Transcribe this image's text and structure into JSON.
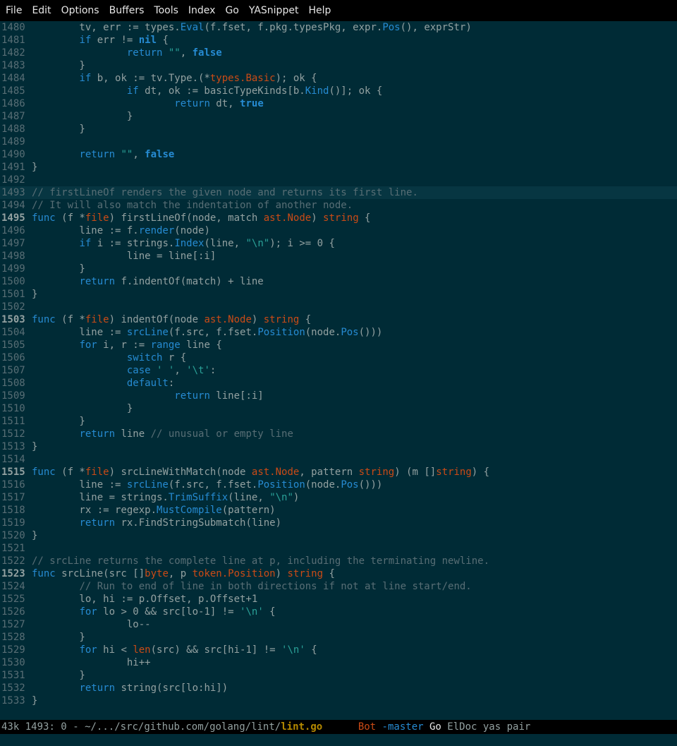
{
  "menu": [
    "File",
    "Edit",
    "Options",
    "Buffers",
    "Tools",
    "Index",
    "Go",
    "YASnippet",
    "Help"
  ],
  "colors": {
    "background": "#002b36",
    "keyword": "#268bd2",
    "type": "#cb4b16",
    "string": "#2aa198",
    "comment": "#586e75",
    "text": "#93a1a1"
  },
  "lines": [
    {
      "n": "1480",
      "tokens": [
        [
          "",
          "        tv, err := types."
        ],
        [
          "call",
          "Eval"
        ],
        [
          "",
          "(f.fset, f.pkg.typesPkg, expr."
        ],
        [
          "call",
          "Pos"
        ],
        [
          "",
          "(), exprStr)"
        ]
      ]
    },
    {
      "n": "1481",
      "tokens": [
        [
          "",
          "        "
        ],
        [
          "kw",
          "if"
        ],
        [
          "",
          " err != "
        ],
        [
          "const",
          "nil"
        ],
        [
          "",
          " {"
        ]
      ]
    },
    {
      "n": "1482",
      "tokens": [
        [
          "",
          "                "
        ],
        [
          "kw",
          "return"
        ],
        [
          "",
          " "
        ],
        [
          "str",
          "\"\""
        ],
        [
          "",
          ", "
        ],
        [
          "const",
          "false"
        ]
      ]
    },
    {
      "n": "1483",
      "tokens": [
        [
          "",
          "        }"
        ]
      ]
    },
    {
      "n": "1484",
      "tokens": [
        [
          "",
          "        "
        ],
        [
          "kw",
          "if"
        ],
        [
          "",
          " b, ok := tv.Type.(*"
        ],
        [
          "type",
          "types.Basic"
        ],
        [
          "",
          "); ok {"
        ]
      ]
    },
    {
      "n": "1485",
      "tokens": [
        [
          "",
          "                "
        ],
        [
          "kw",
          "if"
        ],
        [
          "",
          " dt, ok := basicTypeKinds[b."
        ],
        [
          "call",
          "Kind"
        ],
        [
          "",
          "()]; ok {"
        ]
      ]
    },
    {
      "n": "1486",
      "tokens": [
        [
          "",
          "                        "
        ],
        [
          "kw",
          "return"
        ],
        [
          "",
          " dt, "
        ],
        [
          "const",
          "true"
        ]
      ]
    },
    {
      "n": "1487",
      "tokens": [
        [
          "",
          "                }"
        ]
      ]
    },
    {
      "n": "1488",
      "tokens": [
        [
          "",
          "        }"
        ]
      ]
    },
    {
      "n": "1489",
      "tokens": []
    },
    {
      "n": "1490",
      "tokens": [
        [
          "",
          "        "
        ],
        [
          "kw",
          "return"
        ],
        [
          "",
          " "
        ],
        [
          "str",
          "\"\""
        ],
        [
          "",
          ", "
        ],
        [
          "const",
          "false"
        ]
      ]
    },
    {
      "n": "1491",
      "tokens": [
        [
          "",
          "}"
        ]
      ]
    },
    {
      "n": "1492",
      "tokens": []
    },
    {
      "n": "1493",
      "hl": true,
      "tokens": [
        [
          "cmt",
          "// firstLineOf renders the given node and returns its first line."
        ]
      ]
    },
    {
      "n": "1494",
      "tokens": [
        [
          "cmt",
          "// It will also match the indentation of another node."
        ]
      ]
    },
    {
      "n": "1495",
      "cur": true,
      "tokens": [
        [
          "kw",
          "func"
        ],
        [
          "",
          " (f *"
        ],
        [
          "type",
          "file"
        ],
        [
          "",
          ") firstLineOf(node, match "
        ],
        [
          "type",
          "ast.Node"
        ],
        [
          "",
          ") "
        ],
        [
          "type",
          "string"
        ],
        [
          "",
          " {"
        ]
      ]
    },
    {
      "n": "1496",
      "tokens": [
        [
          "",
          "        line := f."
        ],
        [
          "call",
          "render"
        ],
        [
          "",
          "(node)"
        ]
      ]
    },
    {
      "n": "1497",
      "tokens": [
        [
          "",
          "        "
        ],
        [
          "kw",
          "if"
        ],
        [
          "",
          " i := strings."
        ],
        [
          "call",
          "Index"
        ],
        [
          "",
          "(line, "
        ],
        [
          "str",
          "\"\\n\""
        ],
        [
          "",
          "); i >= 0 {"
        ]
      ]
    },
    {
      "n": "1498",
      "tokens": [
        [
          "",
          "                line = line[:i]"
        ]
      ]
    },
    {
      "n": "1499",
      "tokens": [
        [
          "",
          "        }"
        ]
      ]
    },
    {
      "n": "1500",
      "tokens": [
        [
          "",
          "        "
        ],
        [
          "kw",
          "return"
        ],
        [
          "",
          " f.indentOf(match) + line"
        ]
      ]
    },
    {
      "n": "1501",
      "tokens": [
        [
          "",
          "}"
        ]
      ]
    },
    {
      "n": "1502",
      "tokens": []
    },
    {
      "n": "1503",
      "cur": true,
      "tokens": [
        [
          "kw",
          "func"
        ],
        [
          "",
          " (f *"
        ],
        [
          "type",
          "file"
        ],
        [
          "",
          ") indentOf(node "
        ],
        [
          "type",
          "ast.Node"
        ],
        [
          "",
          ") "
        ],
        [
          "type",
          "string"
        ],
        [
          "",
          " {"
        ]
      ]
    },
    {
      "n": "1504",
      "tokens": [
        [
          "",
          "        line := "
        ],
        [
          "call",
          "srcLine"
        ],
        [
          "",
          "(f.src, f.fset."
        ],
        [
          "call",
          "Position"
        ],
        [
          "",
          "(node."
        ],
        [
          "call",
          "Pos"
        ],
        [
          "",
          "()))"
        ]
      ]
    },
    {
      "n": "1505",
      "tokens": [
        [
          "",
          "        "
        ],
        [
          "kw",
          "for"
        ],
        [
          "",
          " i, r := "
        ],
        [
          "kw",
          "range"
        ],
        [
          "",
          " line {"
        ]
      ]
    },
    {
      "n": "1506",
      "tokens": [
        [
          "",
          "                "
        ],
        [
          "kw",
          "switch"
        ],
        [
          "",
          " r {"
        ]
      ]
    },
    {
      "n": "1507",
      "tokens": [
        [
          "",
          "                "
        ],
        [
          "kw",
          "case"
        ],
        [
          "",
          " "
        ],
        [
          "str",
          "' '"
        ],
        [
          "",
          ", "
        ],
        [
          "str",
          "'\\t'"
        ],
        [
          "",
          ":"
        ]
      ]
    },
    {
      "n": "1508",
      "tokens": [
        [
          "",
          "                "
        ],
        [
          "kw",
          "default"
        ],
        [
          "",
          ":"
        ]
      ]
    },
    {
      "n": "1509",
      "tokens": [
        [
          "",
          "                        "
        ],
        [
          "kw",
          "return"
        ],
        [
          "",
          " line[:i]"
        ]
      ]
    },
    {
      "n": "1510",
      "tokens": [
        [
          "",
          "                }"
        ]
      ]
    },
    {
      "n": "1511",
      "tokens": [
        [
          "",
          "        }"
        ]
      ]
    },
    {
      "n": "1512",
      "tokens": [
        [
          "",
          "        "
        ],
        [
          "kw",
          "return"
        ],
        [
          "",
          " line "
        ],
        [
          "cmt",
          "// unusual or empty line"
        ]
      ]
    },
    {
      "n": "1513",
      "tokens": [
        [
          "",
          "}"
        ]
      ]
    },
    {
      "n": "1514",
      "tokens": []
    },
    {
      "n": "1515",
      "cur": true,
      "tokens": [
        [
          "kw",
          "func"
        ],
        [
          "",
          " (f *"
        ],
        [
          "type",
          "file"
        ],
        [
          "",
          ") srcLineWithMatch(node "
        ],
        [
          "type",
          "ast.Node"
        ],
        [
          "",
          ", pattern "
        ],
        [
          "type",
          "string"
        ],
        [
          "",
          ") (m []"
        ],
        [
          "type",
          "string"
        ],
        [
          "",
          ") {"
        ]
      ]
    },
    {
      "n": "1516",
      "tokens": [
        [
          "",
          "        line := "
        ],
        [
          "call",
          "srcLine"
        ],
        [
          "",
          "(f.src, f.fset."
        ],
        [
          "call",
          "Position"
        ],
        [
          "",
          "(node."
        ],
        [
          "call",
          "Pos"
        ],
        [
          "",
          "()))"
        ]
      ]
    },
    {
      "n": "1517",
      "tokens": [
        [
          "",
          "        line = strings."
        ],
        [
          "call",
          "TrimSuffix"
        ],
        [
          "",
          "(line, "
        ],
        [
          "str",
          "\"\\n\""
        ],
        [
          "",
          ")"
        ]
      ]
    },
    {
      "n": "1518",
      "tokens": [
        [
          "",
          "        rx := regexp."
        ],
        [
          "call",
          "MustCompile"
        ],
        [
          "",
          "(pattern)"
        ]
      ]
    },
    {
      "n": "1519",
      "tokens": [
        [
          "",
          "        "
        ],
        [
          "kw",
          "return"
        ],
        [
          "",
          " rx.FindStringSubmatch(line)"
        ]
      ]
    },
    {
      "n": "1520",
      "tokens": [
        [
          "",
          "}"
        ]
      ]
    },
    {
      "n": "1521",
      "tokens": []
    },
    {
      "n": "1522",
      "tokens": [
        [
          "cmt",
          "// srcLine returns the complete line at p, including the terminating newline."
        ]
      ]
    },
    {
      "n": "1523",
      "cur": true,
      "tokens": [
        [
          "kw",
          "func"
        ],
        [
          "",
          " srcLine(src []"
        ],
        [
          "type",
          "byte"
        ],
        [
          "",
          ", p "
        ],
        [
          "type",
          "token.Position"
        ],
        [
          "",
          ") "
        ],
        [
          "type",
          "string"
        ],
        [
          "",
          " {"
        ]
      ]
    },
    {
      "n": "1524",
      "tokens": [
        [
          "",
          "        "
        ],
        [
          "cmt",
          "// Run to end of line in both directions if not at line start/end."
        ]
      ]
    },
    {
      "n": "1525",
      "tokens": [
        [
          "",
          "        lo, hi := p.Offset, p.Offset+1"
        ]
      ]
    },
    {
      "n": "1526",
      "tokens": [
        [
          "",
          "        "
        ],
        [
          "kw",
          "for"
        ],
        [
          "",
          " lo > 0 && src[lo-1] != "
        ],
        [
          "str",
          "'\\n'"
        ],
        [
          "",
          " {"
        ]
      ]
    },
    {
      "n": "1527",
      "tokens": [
        [
          "",
          "                lo--"
        ]
      ]
    },
    {
      "n": "1528",
      "tokens": [
        [
          "",
          "        }"
        ]
      ]
    },
    {
      "n": "1529",
      "tokens": [
        [
          "",
          "        "
        ],
        [
          "kw",
          "for"
        ],
        [
          "",
          " hi < "
        ],
        [
          "type",
          "len"
        ],
        [
          "",
          "(src) && src[hi-1] != "
        ],
        [
          "str",
          "'\\n'"
        ],
        [
          "",
          " {"
        ]
      ]
    },
    {
      "n": "1530",
      "tokens": [
        [
          "",
          "                hi++"
        ]
      ]
    },
    {
      "n": "1531",
      "tokens": [
        [
          "",
          "        }"
        ]
      ]
    },
    {
      "n": "1532",
      "tokens": [
        [
          "",
          "        "
        ],
        [
          "kw",
          "return"
        ],
        [
          "",
          " string(src[lo:hi])"
        ]
      ]
    },
    {
      "n": "1533",
      "tokens": [
        [
          "",
          "}"
        ]
      ]
    }
  ],
  "modeline": {
    "size": "43k",
    "position": "1493: 0",
    "modified": "-",
    "path": "~/.../src/github.com/golang/lint/",
    "file": "lint.go",
    "scroll": "Bot",
    "branch": "-master",
    "major_mode": "Go",
    "minor_modes": "ElDoc yas pair"
  }
}
